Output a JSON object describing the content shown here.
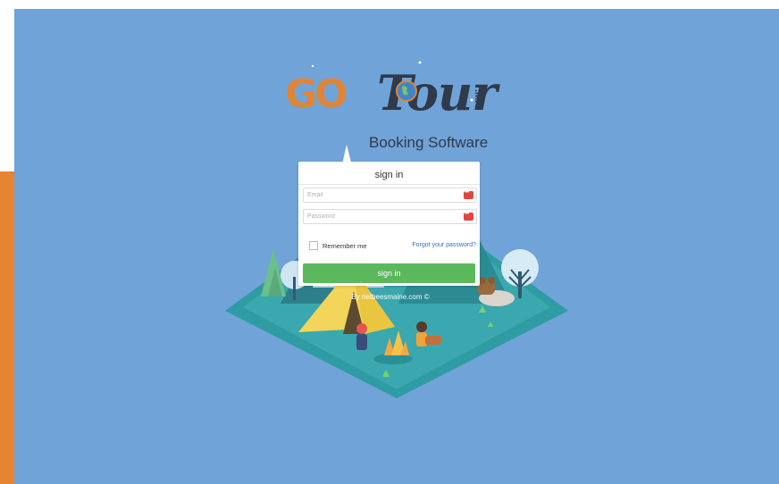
{
  "logo": {
    "go": "GO",
    "tour": "Tour",
    "tld": ".MA",
    "subtitle": "Booking Software"
  },
  "login": {
    "title": "sign in",
    "email_placeholder": "Email",
    "password_placeholder": "Password",
    "remember_label": "Remember me",
    "forgot_link": "Forgot your password?",
    "submit_label": "sign in"
  },
  "footer": {
    "credit": "By netbeesmaine.com ©"
  },
  "colors": {
    "background": "#70a3d8",
    "accent_orange": "#e58433",
    "button_green": "#5cb85c",
    "link_blue": "#3a6fb8"
  }
}
